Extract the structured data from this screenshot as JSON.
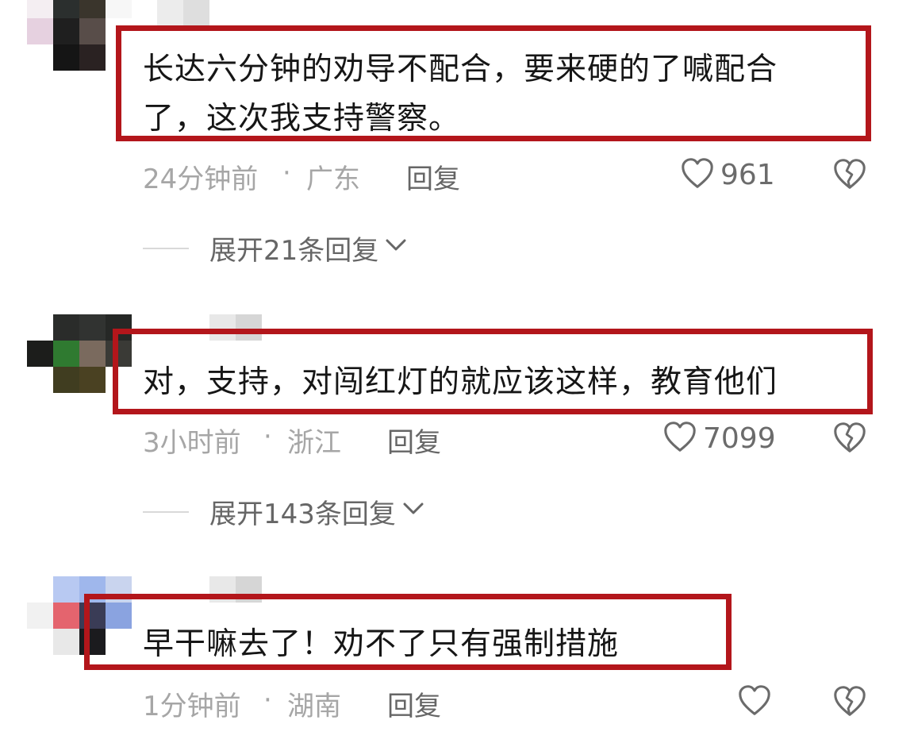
{
  "comments": [
    {
      "text_line1": "长达六分钟的劝导不配合，要来硬的了喊配合",
      "text_line2": "了，这次我支持警察。",
      "time": "24分钟前",
      "separator": "·",
      "location": "广东",
      "reply_label": "回复",
      "likes": "961",
      "expand_label": "展开21条回复"
    },
    {
      "text_line1": "对，支持，对闯红灯的就应该这样，教育他们",
      "time": "3小时前",
      "separator": "·",
      "location": "浙江",
      "reply_label": "回复",
      "likes": "7099",
      "expand_label": "展开143条回复"
    },
    {
      "text_line1": "早干嘛去了！劝不了只有强制措施",
      "time": "1分钟前",
      "separator": "·",
      "location": "湖南",
      "reply_label": "回复",
      "likes": ""
    }
  ],
  "colors": {
    "highlight_frame": "#b3161b",
    "meta_text": "#a6a6a6",
    "action_text": "#666666"
  },
  "icons": {
    "like": "heart-outline-icon",
    "dislike": "broken-heart-icon",
    "expand": "chevron-down-icon"
  }
}
